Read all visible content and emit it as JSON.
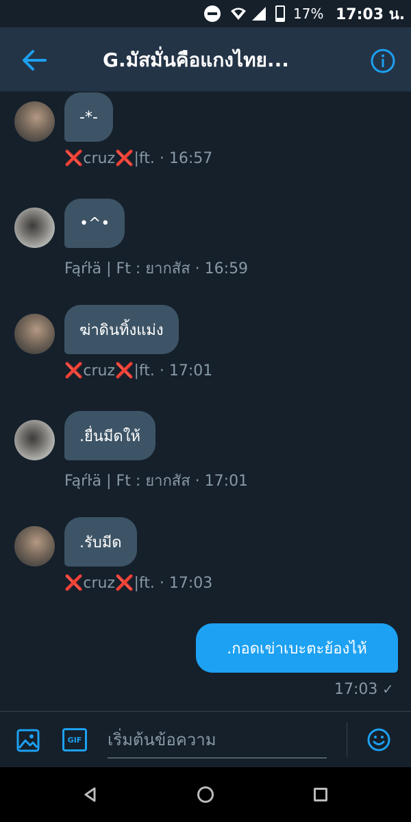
{
  "status_bar": {
    "battery": "17%",
    "time": "17:03 น."
  },
  "header": {
    "title": "G.มัสมั่นคือแกงไทย..."
  },
  "messages": [
    {
      "text": "-*-",
      "sender_prefix": "❌",
      "sender_name": "cruz",
      "sender_suffix": "❌",
      "sender_rest": "|ft.",
      "time": "· 16:57"
    },
    {
      "text": "•^•",
      "sender": "Fąŕŀä | Ft : ยากสัส",
      "time": "· 16:59"
    },
    {
      "text": "ฆ่าดินทิ้งแม่ง",
      "sender_prefix": "❌",
      "sender_name": "cruz",
      "sender_suffix": "❌",
      "sender_rest": "|ft.",
      "time": "· 17:01"
    },
    {
      "text": ".ยื่นมีดให้",
      "sender": "Fąŕŀä | Ft : ยากสัส",
      "time": "· 17:01"
    },
    {
      "text": ".รับมีด",
      "sender_prefix": "❌",
      "sender_name": "cruz",
      "sender_suffix": "❌",
      "sender_rest": "|ft.",
      "time": "· 17:03"
    }
  ],
  "sent": {
    "text": ".กอดเข่าเบะตะย้องไห้",
    "time": "17:03",
    "check": "✓"
  },
  "composer": {
    "placeholder": "เริ่มต้นข้อความ",
    "gif_label": "GIF"
  },
  "icons": {
    "back": "arrow-left-icon",
    "info": "info-icon",
    "media": "image-icon",
    "emoji": "smile-icon"
  },
  "colors": {
    "accent": "#1da1f2",
    "bubble": "#3d5466",
    "background": "#15202b",
    "header": "#243447",
    "muted": "#8899a6",
    "x_mark": "#e0245e"
  }
}
